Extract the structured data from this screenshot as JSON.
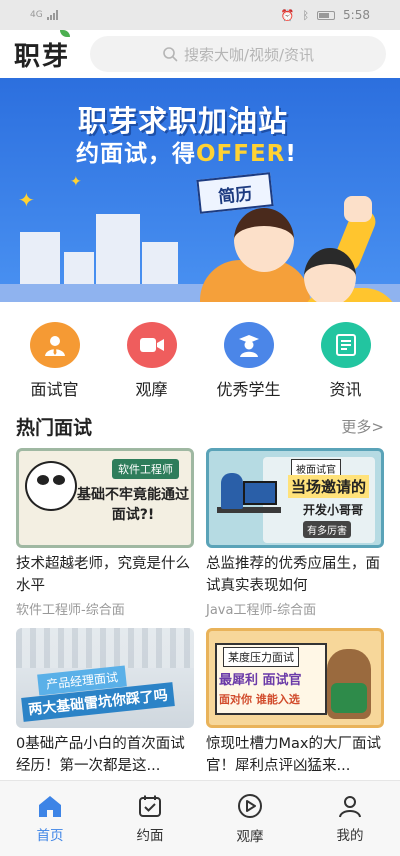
{
  "status_bar": {
    "time": "5:58"
  },
  "header": {
    "logo_text": "职芽",
    "search_placeholder": "搜索大咖/视频/资讯"
  },
  "banner": {
    "title": "职芽求职加油站",
    "subtitle_prefix": "约面试，得",
    "subtitle_highlight": "OFFER",
    "subtitle_suffix": "!",
    "card_text": "简历"
  },
  "quick_nav": [
    {
      "label": "面试官",
      "icon": "interviewer-icon",
      "color": "#f59a34"
    },
    {
      "label": "观摩",
      "icon": "video-camera-icon",
      "color": "#ef5d5d"
    },
    {
      "label": "优秀学生",
      "icon": "graduate-icon",
      "color": "#4b86e8"
    },
    {
      "label": "资讯",
      "icon": "news-icon",
      "color": "#22c5a0"
    }
  ],
  "section": {
    "title": "热门面试",
    "more": "更多>"
  },
  "cards": [
    {
      "title": "技术超越老师，究竟是什么水平",
      "meta": "软件工程师-综合面",
      "thumb_tag": "软件工程师",
      "thumb_text": "基础不牢竟能通过面试?!"
    },
    {
      "title": "总监推荐的优秀应届生，面试真实表现如何",
      "meta": "Java工程师-综合面",
      "thumb_l1": "被面试官",
      "thumb_l2": "当场邀请的",
      "thumb_l3": "开发小哥哥",
      "thumb_l4": "有多厉害"
    },
    {
      "title": "0基础产品小白的首次面试经历！第一次都是这...",
      "meta": "",
      "thumb_ribbon": "产品经理面试",
      "thumb_big": "两大基础雷坑你踩了吗"
    },
    {
      "title": "惊现吐槽力Max的大厂面试官！犀利点评凶猛来...",
      "meta": "",
      "thumb_l1": "某度压力面试",
      "thumb_l2": "最犀利 面试官",
      "thumb_l3": "面对你 谁能入选"
    }
  ],
  "tabbar": [
    {
      "label": "首页",
      "icon": "home-icon",
      "active": true
    },
    {
      "label": "约面",
      "icon": "calendar-check-icon",
      "active": false
    },
    {
      "label": "观摩",
      "icon": "play-circle-icon",
      "active": false
    },
    {
      "label": "我的",
      "icon": "user-icon",
      "active": false
    }
  ],
  "colors": {
    "accent": "#3d84e6",
    "banner_blue": "#2c6fde"
  }
}
